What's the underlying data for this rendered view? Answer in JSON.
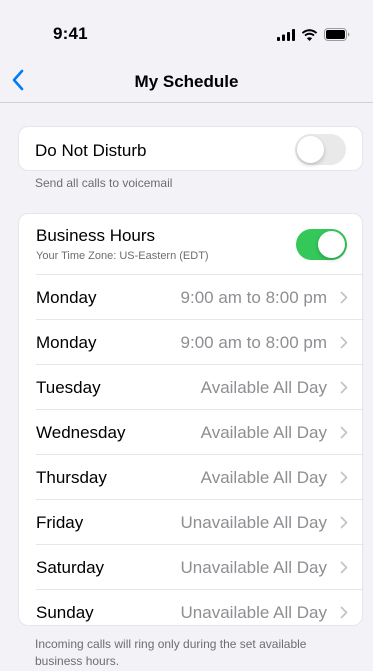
{
  "status_bar": {
    "time": "9:41",
    "icons": [
      "signal-icon",
      "wifi-icon",
      "battery-icon"
    ]
  },
  "nav": {
    "title": "My Schedule",
    "back_icon": "chevron-left-icon"
  },
  "do_not_disturb": {
    "label": "Do Not Disturb",
    "enabled": false,
    "footnote": "Send all calls to voicemail"
  },
  "business_hours": {
    "title": "Business Hours",
    "subtitle": "Your Time Zone: US-Eastern (EDT)",
    "enabled": true,
    "rows": [
      {
        "day": "Monday",
        "value": "9:00 am to 8:00 pm"
      },
      {
        "day": "Monday",
        "value": "9:00 am to 8:00 pm"
      },
      {
        "day": "Tuesday",
        "value": "Available All Day"
      },
      {
        "day": "Wednesday",
        "value": "Available All Day"
      },
      {
        "day": "Thursday",
        "value": "Available All Day"
      },
      {
        "day": "Friday",
        "value": "Unavailable All Day"
      },
      {
        "day": "Saturday",
        "value": "Unavailable All Day"
      },
      {
        "day": "Sunday",
        "value": "Unavailable All Day"
      }
    ],
    "footnote": "Incoming calls will ring only during the set available business hours."
  },
  "colors": {
    "accent": "#007aff",
    "toggle_on": "#34c759",
    "toggle_off": "#e9e9ea",
    "secondary_text": "#8e8e93"
  }
}
